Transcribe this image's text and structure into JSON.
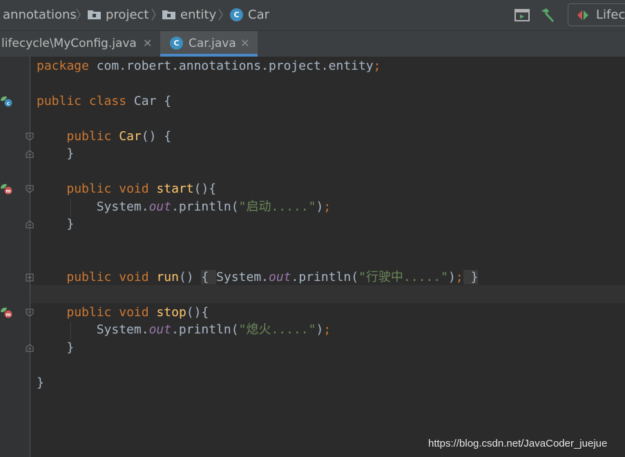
{
  "breadcrumb": {
    "items": [
      "annotations",
      "project",
      "entity",
      "Car"
    ]
  },
  "toolbar": {
    "run_config_label": "Lifecycle"
  },
  "tabs": [
    {
      "label": "lifecycle\\MyConfig.java",
      "active": false
    },
    {
      "label": "Car.java",
      "active": true
    }
  ],
  "code": {
    "package_kw": "package",
    "package_name": " com.robert.annotations.project.entity",
    "semicolon": ";",
    "kw_public": "public",
    "kw_class": "class",
    "kw_void": "void",
    "class_name": "Car",
    "constructor_name": "Car",
    "method_start": "start",
    "method_run": "run",
    "method_stop": "stop",
    "system": "System.",
    "out": "out",
    "println": ".println(",
    "str_start": "\"启动.....\"",
    "str_run": "\"行驶中.....\"",
    "str_stop": "\"熄火.....\""
  },
  "watermark": "https://blog.csdn.net/JavaCoder_juejue",
  "colors": {
    "keyword": "#cc7832",
    "function": "#ffc66d",
    "string": "#6a8759",
    "field": "#9876aa",
    "text": "#a9b7c6",
    "accent": "#4a88c7"
  }
}
